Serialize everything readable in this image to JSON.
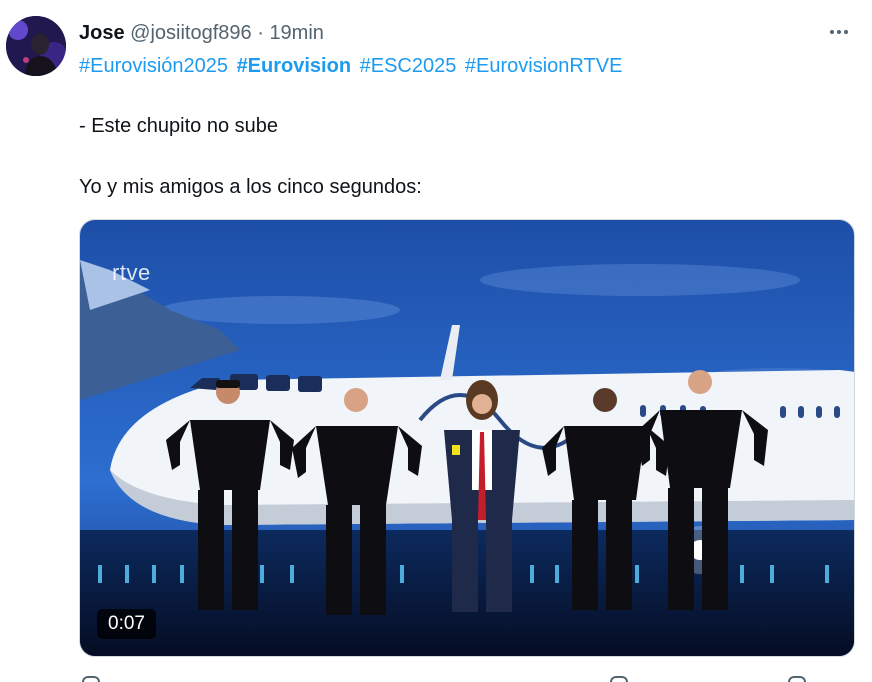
{
  "tweet": {
    "author_name": "Jose",
    "handle": "@josiitogf896",
    "separator": "·",
    "time": "19min",
    "hashtags": [
      {
        "text": "#Eurovisión2025",
        "bold": false
      },
      {
        "text": "#Eurovision",
        "bold": true
      },
      {
        "text": "#ESC2025",
        "bold": false
      },
      {
        "text": "#EurovisionRTVE",
        "bold": false
      }
    ],
    "line1": "- Este chupito no sube",
    "line2": "Yo y mis amigos a los cinco segundos:"
  },
  "media": {
    "watermark": "rtve",
    "duration": "0:07"
  },
  "colors": {
    "link": "#1d9bf0",
    "secondary_text": "#536471",
    "primary_text": "#0f1419"
  },
  "icons": [
    "more-icon",
    "avatar"
  ]
}
